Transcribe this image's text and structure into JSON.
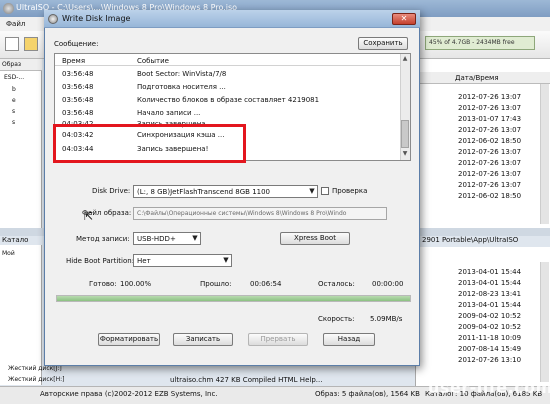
{
  "background": {
    "title": "UltraISO - C:\\Users\\...\\Windows 8 Pro\\Windows 8 Pro.iso",
    "menu_file": "Файл",
    "size_box": "45% of 4.7GB - 2434MB free",
    "left_header": "Образ",
    "tree_root": "ESD-...",
    "tree_rows": [
      "b",
      "e",
      "s",
      "s"
    ],
    "date_header": "Дата/Время",
    "dates_top": [
      "2012-07-26 13:07",
      "2012-07-26 13:07",
      "2013-01-07 17:43",
      "2012-07-26 13:07",
      "2012-06-02 18:50",
      "2012-07-26 13:07",
      "2012-07-26 13:07",
      "2012-07-26 13:07",
      "2012-07-26 13:07",
      "2012-06-02 18:50"
    ],
    "catalog_label": "Катало",
    "left_bottom_rows": [
      "Мой",
      "",
      "",
      "",
      "",
      "",
      "",
      "",
      "",
      "",
      "",
      ""
    ],
    "path_right": "2901 Portable\\App\\UltraISO",
    "dates_bottom": [
      "2013-04-01 15:44",
      "2013-04-01 15:44",
      "2012-08-23 13:41",
      "2013-04-01 15:44",
      "2009-04-02 10:52",
      "2009-04-02 10:52",
      "2011-11-18 10:09",
      "2007-08-14 15:49",
      "2012-07-26 13:10"
    ],
    "hdd_left1": "Жесткий диск[J:]",
    "hdd_left2": "Жесткий диск[H:]",
    "bottom_row": "ultraiso.chm        427 KB    Compiled HTML Help...",
    "copyright": "Авторские права (c)2002-2012 EZB Systems, Inc.",
    "image_info": "Образ: 5 файла(ов), 1564 KB",
    "catalog_info": "Каталог: 10 файла(ов), 6185 KB",
    "watermark": "user-life.com"
  },
  "dialog": {
    "title": "Write Disk Image",
    "message_label": "Сообщение:",
    "save_button": "Сохранить",
    "log_headers": {
      "time": "Время",
      "event": "Событие"
    },
    "log": [
      {
        "time": "03:56:48",
        "event": "Boot Sector: WinVista/7/8"
      },
      {
        "time": "03:56:48",
        "event": "Подготовка носителя ..."
      },
      {
        "time": "03:56:48",
        "event": "Количество блоков в образе составляет 4219081"
      },
      {
        "time": "03:56:48",
        "event": "Начало записи ..."
      },
      {
        "time": "04:03:42",
        "event": "Запись завершена"
      },
      {
        "time": "04:03:42",
        "event": "Синхронизация кэша ..."
      },
      {
        "time": "04:03:44",
        "event": "Запись завершена!"
      }
    ],
    "disk_drive_label": "Disk Drive:",
    "disk_drive_value": "(L:, 8 GB)JetFlashTranscend 8GB    1100",
    "verify_label": "Проверка",
    "file_label": "Файл образа:",
    "file_value": "C:\\Файлы\\Операционные системы\\Windows 8\\Windows 8 Pro\\Windo",
    "method_label": "Метод записи:",
    "method_value": "USB-HDD+",
    "xpress_boot": "Xpress Boot",
    "hide_boot_label": "Hide Boot Partition:",
    "hide_boot_value": "Нет",
    "done_label": "Готово:",
    "done_value": "100.00%",
    "elapsed_label": "Прошло:",
    "elapsed_value": "00:06:54",
    "remaining_label": "Осталось:",
    "remaining_value": "00:00:00",
    "speed_label": "Скорость:",
    "speed_value": "5.09MB/s",
    "progress": 1.0,
    "btn_format": "Форматировать",
    "btn_write": "Записать",
    "btn_abort": "Прервать",
    "btn_back": "Назад"
  },
  "colors": {
    "highlight": "#e3161e",
    "progress": "#8cc282",
    "accent": "#97b6d8"
  }
}
